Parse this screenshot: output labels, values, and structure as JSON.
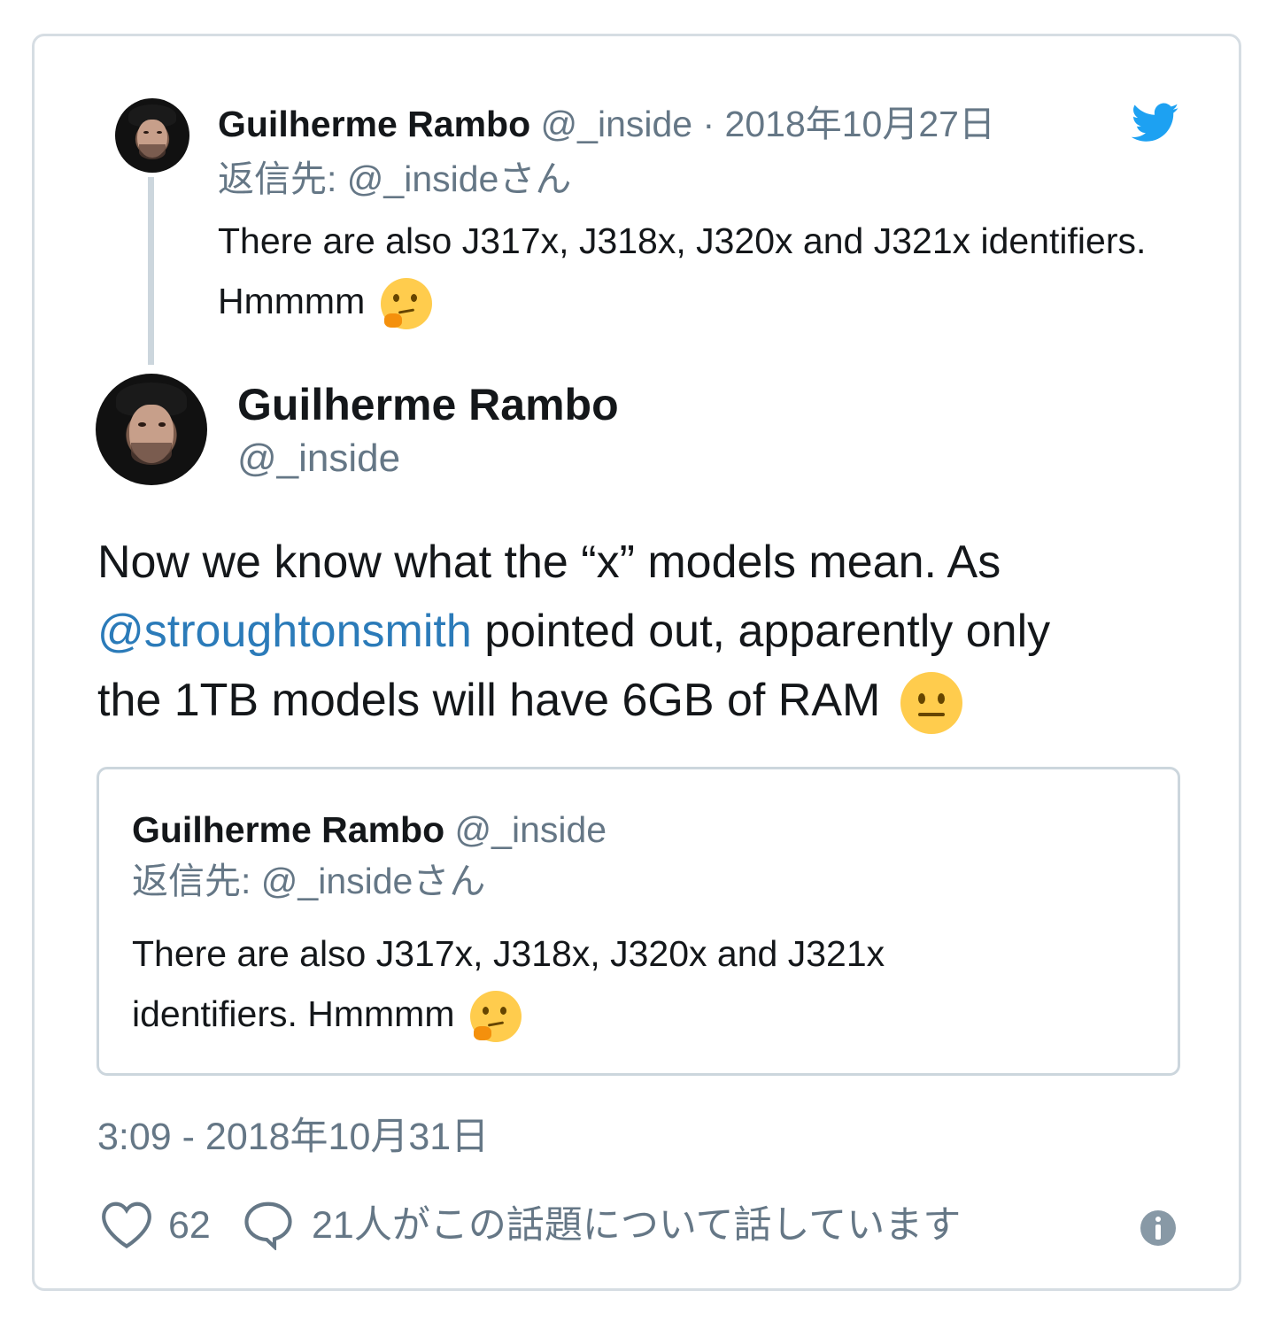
{
  "parent_tweet": {
    "name": "Guilherme Rambo",
    "handle": "@_inside",
    "separator": " · ",
    "date": "2018年10月27日",
    "reply_to": "返信先: @_insideさん",
    "text": "There are also J317x, J318x, J320x and J321x identifiers. Hmmmm",
    "emoji": "thinking-face"
  },
  "main_tweet": {
    "name": "Guilherme Rambo",
    "handle": "@_inside",
    "text_1": "Now we know what the “x” models mean. As",
    "mention": "@stroughtonsmith",
    "text_2": " pointed out, apparently only",
    "text_3": "the 1TB models will have 6GB of RAM",
    "emoji": "neutral-face",
    "timestamp": "3:09 - 2018年10月31日"
  },
  "quoted_tweet": {
    "name": "Guilherme Rambo",
    "handle": "@_inside",
    "reply_to": "返信先: @_insideさん",
    "text": "There are also J317x, J318x, J320x and J321x identifiers. Hmmmm",
    "emoji": "thinking-face"
  },
  "footer": {
    "likes": "62",
    "conversation": "21人がこの話題について話しています"
  },
  "colors": {
    "link": "#2b7bb9",
    "twitter_blue": "#1da1f2",
    "muted": "#657786"
  }
}
